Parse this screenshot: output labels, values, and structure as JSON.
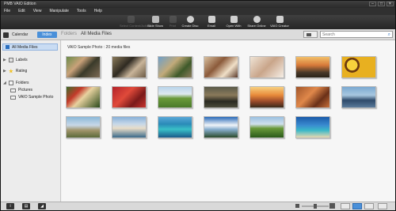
{
  "window": {
    "title": "PMB VAIO Edition",
    "controls": [
      "–",
      "□",
      "✕"
    ]
  },
  "menu": [
    "File",
    "Edit",
    "View",
    "Manipulate",
    "Tools",
    "Help"
  ],
  "toolbar": [
    {
      "label": "Select Content/Action",
      "icon": "select-content-icon",
      "enabled": false,
      "color": "#888888"
    },
    {
      "label": "Slide Show",
      "icon": "slide-show-icon",
      "enabled": true,
      "color": "#bbbbbb"
    },
    {
      "label": "Print",
      "icon": "print-icon",
      "enabled": false,
      "color": "#888888"
    },
    {
      "label": "Create Disc",
      "icon": "create-disc-icon",
      "enabled": true,
      "color": "#d0d0d0"
    },
    {
      "label": "Email",
      "icon": "email-icon",
      "enabled": true,
      "color": "#d0d0d0"
    },
    {
      "label": "Open With",
      "icon": "open-with-icon",
      "enabled": true,
      "color": "#d0d0d0"
    },
    {
      "label": "Share Online",
      "icon": "share-online-icon",
      "enabled": true,
      "color": "#d0d0d0"
    },
    {
      "label": "VAIO Creator",
      "icon": "vaio-creator-icon",
      "enabled": true,
      "color": "#d0d0d0"
    }
  ],
  "nav": {
    "calendar_label": "Calendar",
    "folders_tab": "Index",
    "crumb_1": "Folders",
    "crumb_2": "All Media Files",
    "search_placeholder": "Search"
  },
  "sidebar": {
    "all_media": "All Media Files",
    "labels": "Labels",
    "rating": "Rating",
    "folders": "Folders",
    "sub_folders": [
      "Pictures",
      "VAIO Sample Photo"
    ]
  },
  "main": {
    "caption": "VAIO Sample Photo : 20 media files",
    "thumbnails": [
      {
        "name": "people-at-table",
        "bg": "linear-gradient(135deg,#6b8b4a 0%,#c9a27a 35%,#3a3a2a 60%,#7d6b55 100%)"
      },
      {
        "name": "people-group",
        "bg": "linear-gradient(135deg,#8a7a5a 0%,#2f2a22 40%,#c9b59a 65%,#6b5a45 100%)"
      },
      {
        "name": "people-outdoors",
        "bg": "linear-gradient(135deg,#6fa0c9 0%,#c2aa7a 40%,#3e5a2a 70%,#8c7c5c 100%)"
      },
      {
        "name": "kitchen-people",
        "bg": "linear-gradient(135deg,#d8c0a0 0%,#8b5a3a 40%,#f0e0c8 70%,#5a3a2a 100%)"
      },
      {
        "name": "baby",
        "bg": "linear-gradient(135deg,#efe4d6 0%,#c9a58a 50%,#f6efe6 100%)"
      },
      {
        "name": "sunset-field",
        "bg": "linear-gradient(180deg,#f2c06a 0%,#d87a3a 40%,#4a3a2a 75%,#2a2218 100%)"
      },
      {
        "name": "sunflowers",
        "bg": "radial-gradient(circle at 30% 40%,#f7d23c 0 20%,#6b3a10 21% 28%,#e8b020 29%),#d09020"
      },
      {
        "name": "watermelons",
        "bg": "linear-gradient(135deg,#3e6b2a 0%,#c33a2a 30%,#e8d2a0 50%,#2a4a1a 100%)"
      },
      {
        "name": "strawberries",
        "bg": "linear-gradient(135deg,#b3232a 0%,#e04a3a 40%,#7a1a1a 70%,#c8342e 100%)"
      },
      {
        "name": "green-field",
        "bg": "linear-gradient(180deg,#b8d4ea 0%,#dfe9ef 35%,#6a9a3a 55%,#4a7a2a 100%)"
      },
      {
        "name": "dusk-river",
        "bg": "linear-gradient(180deg,#5a5a4a 0%,#8a7a5a 40%,#2a2a22 70%,#4a4a3a 100%)"
      },
      {
        "name": "orange-sunset",
        "bg": "linear-gradient(180deg,#f7d080 0%,#e88a3a 40%,#9a4a2a 70%,#3a2a1a 100%)"
      },
      {
        "name": "wood-interior",
        "bg": "linear-gradient(135deg,#a0552a 0%,#e0884a 40%,#6a3018 70%,#c8703a 100%)"
      },
      {
        "name": "lake-dock",
        "bg": "linear-gradient(180deg,#7aa8d0 0%,#a8c8e0 40%,#2e4a6a 65%,#5a7a9a 100%)"
      },
      {
        "name": "stone-ruins",
        "bg": "linear-gradient(180deg,#8ab8d8 0%,#c8d8e8 40%,#a0946a 65%,#5a6a3a 100%)"
      },
      {
        "name": "harbor-town",
        "bg": "linear-gradient(180deg,#88b0d8 0%,#c8d8e8 35%,#e8dcc8 55%,#3a6a8a 100%)"
      },
      {
        "name": "turquoise-sea",
        "bg": "linear-gradient(180deg,#5aa8d8 0%,#2a8ab8 35%,#3ac0c8 60%,#1a5a8a 100%)"
      },
      {
        "name": "clouds-palms",
        "bg": "linear-gradient(180deg,#2a6ab8 0%,#f0f4f8 40%,#8ab0d0 60%,#2a4a2a 100%)"
      },
      {
        "name": "green-hills",
        "bg": "linear-gradient(180deg,#9ac0e0 0%,#d0e0ec 35%,#6a9a3a 55%,#2a5a1a 100%)"
      },
      {
        "name": "palm-beach",
        "bg": "linear-gradient(180deg,#1a5aa8 0%,#3a8ad0 40%,#3ab8c8 65%,#e8d8b0 100%)"
      }
    ]
  },
  "bottom": {
    "left_buttons": [
      "i",
      "▤",
      "◢"
    ],
    "view_modes": [
      "list-view",
      "thumbnail-view",
      "large-thumbnail-view"
    ],
    "active_view": 1,
    "zoom_level": 0.5
  },
  "colors": {
    "accent": "#4a90d9",
    "toolbar_bg": "#303030",
    "sidebar_selected": "#c9dcf3"
  }
}
